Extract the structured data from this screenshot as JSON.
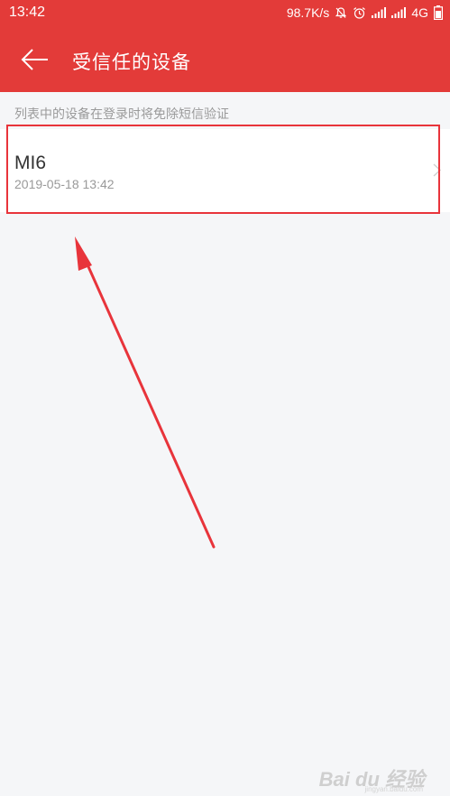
{
  "status_bar": {
    "time": "13:42",
    "speed": "98.7K/s",
    "network": "4G",
    "icons": [
      "mute-bell-icon",
      "alarm-icon",
      "signal-icon",
      "signal-icon"
    ]
  },
  "header": {
    "back_icon": "arrow-left-icon",
    "title": "受信任的设备"
  },
  "hint": "列表中的设备在登录时将免除短信验证",
  "devices": [
    {
      "name": "MI6",
      "time": "2019-05-18 13:42",
      "icon": "chevron-right-icon"
    }
  ],
  "annotation": {
    "highlight_color": "#e8343b",
    "arrow_color": "#e8343b"
  },
  "watermark": {
    "logo": "Bai du 经验",
    "sub": "jingyan.baidu.com"
  },
  "colors": {
    "header_bg": "#e33b39",
    "page_bg": "#f5f6f8"
  }
}
